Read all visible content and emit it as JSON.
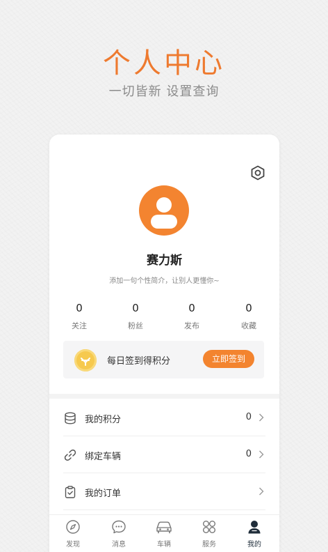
{
  "promo": {
    "title": "个人中心",
    "subtitle": "一切皆新 设置查询"
  },
  "profile": {
    "username": "赛力斯",
    "bio": "添加一句个性简介，让别人更懂你~"
  },
  "stats": [
    {
      "value": "0",
      "label": "关注"
    },
    {
      "value": "0",
      "label": "粉丝"
    },
    {
      "value": "0",
      "label": "发布"
    },
    {
      "value": "0",
      "label": "收藏"
    }
  ],
  "signin": {
    "text": "每日签到得积分",
    "button": "立即签到"
  },
  "menu": [
    {
      "label": "我的积分",
      "count": "0",
      "icon": "coins-stack-icon"
    },
    {
      "label": "绑定车辆",
      "count": "0",
      "icon": "link-icon"
    },
    {
      "label": "我的订单",
      "count": "",
      "icon": "clipboard-check-icon"
    }
  ],
  "tabs": [
    {
      "label": "发现",
      "icon": "compass-icon"
    },
    {
      "label": "消息",
      "icon": "chat-bubble-icon"
    },
    {
      "label": "车辆",
      "icon": "car-icon"
    },
    {
      "label": "服务",
      "icon": "service-grid-icon"
    },
    {
      "label": "我的",
      "icon": "user-icon",
      "active": true
    }
  ],
  "colors": {
    "accent": "#f3842f",
    "headline": "#ee7a2f",
    "coin": "#f6c94e",
    "active_tab": "#1f2d3a"
  }
}
